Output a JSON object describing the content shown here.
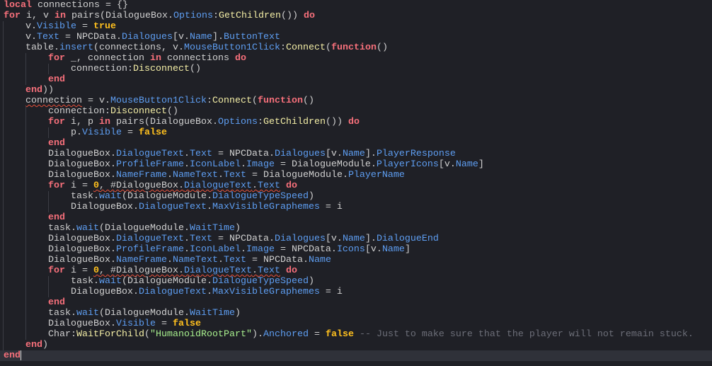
{
  "editor": {
    "current_line": 33,
    "lines": [
      {
        "indent": 0,
        "tokens": [
          [
            "k",
            "local"
          ],
          [
            "t",
            " connections = {}"
          ]
        ]
      },
      {
        "indent": 0,
        "tokens": [
          [
            "k",
            "for"
          ],
          [
            "t",
            " i, v "
          ],
          [
            "k",
            "in"
          ],
          [
            "t",
            " pairs(DialogueBox."
          ],
          [
            "p",
            "Options"
          ],
          [
            "t",
            ":"
          ],
          [
            "m",
            "GetChildren"
          ],
          [
            "t",
            "()) "
          ],
          [
            "k",
            "do"
          ]
        ]
      },
      {
        "indent": 1,
        "tokens": [
          [
            "t",
            "v."
          ],
          [
            "p",
            "Visible"
          ],
          [
            "t",
            " = "
          ],
          [
            "b",
            "true"
          ]
        ]
      },
      {
        "indent": 1,
        "tokens": [
          [
            "t",
            "v."
          ],
          [
            "p",
            "Text"
          ],
          [
            "t",
            " = NPCData."
          ],
          [
            "p",
            "Dialogues"
          ],
          [
            "t",
            "[v."
          ],
          [
            "p",
            "Name"
          ],
          [
            "t",
            "]."
          ],
          [
            "p",
            "ButtonText"
          ]
        ]
      },
      {
        "indent": 1,
        "tokens": [
          [
            "t",
            "table."
          ],
          [
            "p",
            "insert"
          ],
          [
            "t",
            "(connections, v."
          ],
          [
            "p",
            "MouseButton1Click"
          ],
          [
            "t",
            ":"
          ],
          [
            "m",
            "Connect"
          ],
          [
            "t",
            "("
          ],
          [
            "k",
            "function"
          ],
          [
            "t",
            "()"
          ]
        ]
      },
      {
        "indent": 2,
        "tokens": [
          [
            "k",
            "for"
          ],
          [
            "t",
            " _, connection "
          ],
          [
            "k",
            "in"
          ],
          [
            "t",
            " connections "
          ],
          [
            "k",
            "do"
          ]
        ]
      },
      {
        "indent": 3,
        "tokens": [
          [
            "t",
            "connection:"
          ],
          [
            "m",
            "Disconnect"
          ],
          [
            "t",
            "()"
          ]
        ]
      },
      {
        "indent": 2,
        "tokens": [
          [
            "k",
            "end"
          ]
        ]
      },
      {
        "indent": 1,
        "tokens": [
          [
            "k",
            "end"
          ],
          [
            "t",
            "))"
          ]
        ]
      },
      {
        "indent": 1,
        "tokens": [
          [
            "t u",
            "connection"
          ],
          [
            "t",
            " = v."
          ],
          [
            "p",
            "MouseButton1Click"
          ],
          [
            "t",
            ":"
          ],
          [
            "m",
            "Connect"
          ],
          [
            "t",
            "("
          ],
          [
            "k",
            "function"
          ],
          [
            "t",
            "()"
          ]
        ]
      },
      {
        "indent": 2,
        "tokens": [
          [
            "t",
            "connection:"
          ],
          [
            "m",
            "Disconnect"
          ],
          [
            "t",
            "()"
          ]
        ]
      },
      {
        "indent": 2,
        "tokens": [
          [
            "k",
            "for"
          ],
          [
            "t",
            " i, p "
          ],
          [
            "k",
            "in"
          ],
          [
            "t",
            " pairs(DialogueBox."
          ],
          [
            "p",
            "Options"
          ],
          [
            "t",
            ":"
          ],
          [
            "m",
            "GetChildren"
          ],
          [
            "t",
            "()) "
          ],
          [
            "k",
            "do"
          ]
        ]
      },
      {
        "indent": 3,
        "tokens": [
          [
            "t",
            "p."
          ],
          [
            "p",
            "Visible"
          ],
          [
            "t",
            " = "
          ],
          [
            "b",
            "false"
          ]
        ]
      },
      {
        "indent": 2,
        "tokens": [
          [
            "k",
            "end"
          ]
        ]
      },
      {
        "indent": 2,
        "tokens": [
          [
            "t",
            "DialogueBox."
          ],
          [
            "p",
            "DialogueText"
          ],
          [
            "t",
            "."
          ],
          [
            "p",
            "Text"
          ],
          [
            "t",
            " = NPCData."
          ],
          [
            "p",
            "Dialogues"
          ],
          [
            "t",
            "[v."
          ],
          [
            "p",
            "Name"
          ],
          [
            "t",
            "]."
          ],
          [
            "p",
            "PlayerResponse"
          ]
        ]
      },
      {
        "indent": 2,
        "tokens": [
          [
            "t",
            "DialogueBox."
          ],
          [
            "p",
            "ProfileFrame"
          ],
          [
            "t",
            "."
          ],
          [
            "p",
            "IconLabel"
          ],
          [
            "t",
            "."
          ],
          [
            "p",
            "Image"
          ],
          [
            "t",
            " = DialogueModule."
          ],
          [
            "p",
            "PlayerIcons"
          ],
          [
            "t",
            "[v."
          ],
          [
            "p",
            "Name"
          ],
          [
            "t",
            "]"
          ]
        ]
      },
      {
        "indent": 2,
        "tokens": [
          [
            "t",
            "DialogueBox."
          ],
          [
            "p",
            "NameFrame"
          ],
          [
            "t",
            "."
          ],
          [
            "p",
            "NameText"
          ],
          [
            "t",
            "."
          ],
          [
            "p",
            "Text"
          ],
          [
            "t",
            " = DialogueModule."
          ],
          [
            "p",
            "PlayerName"
          ]
        ]
      },
      {
        "indent": 2,
        "tokens": [
          [
            "k",
            "for"
          ],
          [
            "t",
            " i = "
          ],
          [
            "b u",
            "0"
          ],
          [
            "t u",
            ", #DialogueBox."
          ],
          [
            "p u",
            "DialogueText"
          ],
          [
            "t u",
            "."
          ],
          [
            "p u",
            "Text"
          ],
          [
            "t",
            " "
          ],
          [
            "k",
            "do"
          ]
        ]
      },
      {
        "indent": 3,
        "tokens": [
          [
            "t",
            "task."
          ],
          [
            "p",
            "wait"
          ],
          [
            "t",
            "(DialogueModule."
          ],
          [
            "p",
            "DialogueTypeSpeed"
          ],
          [
            "t",
            ")"
          ]
        ]
      },
      {
        "indent": 3,
        "tokens": [
          [
            "t",
            "DialogueBox."
          ],
          [
            "p",
            "DialogueText"
          ],
          [
            "t",
            "."
          ],
          [
            "p",
            "MaxVisibleGraphemes"
          ],
          [
            "t",
            " = i"
          ]
        ]
      },
      {
        "indent": 2,
        "tokens": [
          [
            "k",
            "end"
          ]
        ]
      },
      {
        "indent": 2,
        "tokens": [
          [
            "t",
            "task."
          ],
          [
            "p",
            "wait"
          ],
          [
            "t",
            "(DialogueModule."
          ],
          [
            "p",
            "WaitTime"
          ],
          [
            "t",
            ")"
          ]
        ]
      },
      {
        "indent": 2,
        "tokens": [
          [
            "t",
            "DialogueBox."
          ],
          [
            "p",
            "DialogueText"
          ],
          [
            "t",
            "."
          ],
          [
            "p",
            "Text"
          ],
          [
            "t",
            " = NPCData."
          ],
          [
            "p",
            "Dialogues"
          ],
          [
            "t",
            "[v."
          ],
          [
            "p",
            "Name"
          ],
          [
            "t",
            "]."
          ],
          [
            "p",
            "DialogueEnd"
          ]
        ]
      },
      {
        "indent": 2,
        "tokens": [
          [
            "t",
            "DialogueBox."
          ],
          [
            "p",
            "ProfileFrame"
          ],
          [
            "t",
            "."
          ],
          [
            "p",
            "IconLabel"
          ],
          [
            "t",
            "."
          ],
          [
            "p",
            "Image"
          ],
          [
            "t",
            " = NPCData."
          ],
          [
            "p",
            "Icons"
          ],
          [
            "t",
            "[v."
          ],
          [
            "p",
            "Name"
          ],
          [
            "t",
            "]"
          ]
        ]
      },
      {
        "indent": 2,
        "tokens": [
          [
            "t",
            "DialogueBox."
          ],
          [
            "p",
            "NameFrame"
          ],
          [
            "t",
            "."
          ],
          [
            "p",
            "NameText"
          ],
          [
            "t",
            "."
          ],
          [
            "p",
            "Text"
          ],
          [
            "t",
            " = NPCData."
          ],
          [
            "p",
            "Name"
          ]
        ]
      },
      {
        "indent": 2,
        "tokens": [
          [
            "k",
            "for"
          ],
          [
            "t",
            " i = "
          ],
          [
            "b u",
            "0"
          ],
          [
            "t u",
            ", #DialogueBox."
          ],
          [
            "p u",
            "DialogueText"
          ],
          [
            "t u",
            "."
          ],
          [
            "p u",
            "Text"
          ],
          [
            "t",
            " "
          ],
          [
            "k",
            "do"
          ]
        ]
      },
      {
        "indent": 3,
        "tokens": [
          [
            "t",
            "task."
          ],
          [
            "p",
            "wait"
          ],
          [
            "t",
            "(DialogueModule."
          ],
          [
            "p",
            "DialogueTypeSpeed"
          ],
          [
            "t",
            ")"
          ]
        ]
      },
      {
        "indent": 3,
        "tokens": [
          [
            "t",
            "DialogueBox."
          ],
          [
            "p",
            "DialogueText"
          ],
          [
            "t",
            "."
          ],
          [
            "p",
            "MaxVisibleGraphemes"
          ],
          [
            "t",
            " = i"
          ]
        ]
      },
      {
        "indent": 2,
        "tokens": [
          [
            "k",
            "end"
          ]
        ]
      },
      {
        "indent": 2,
        "tokens": [
          [
            "t",
            "task."
          ],
          [
            "p",
            "wait"
          ],
          [
            "t",
            "(DialogueModule."
          ],
          [
            "p",
            "WaitTime"
          ],
          [
            "t",
            ")"
          ]
        ]
      },
      {
        "indent": 2,
        "tokens": [
          [
            "t",
            "DialogueBox."
          ],
          [
            "p",
            "Visible"
          ],
          [
            "t",
            " = "
          ],
          [
            "b",
            "false"
          ]
        ]
      },
      {
        "indent": 2,
        "tokens": [
          [
            "t",
            "Char:"
          ],
          [
            "m",
            "WaitForChild"
          ],
          [
            "t",
            "("
          ],
          [
            "s",
            "\"HumanoidRootPart\""
          ],
          [
            "t",
            ")."
          ],
          [
            "p",
            "Anchored"
          ],
          [
            "t",
            " = "
          ],
          [
            "b",
            "false"
          ],
          [
            "c",
            " -- Just to make sure that the player will not remain stuck."
          ]
        ]
      },
      {
        "indent": 1,
        "tokens": [
          [
            "k",
            "end"
          ],
          [
            "t",
            ")"
          ]
        ]
      },
      {
        "indent": 0,
        "tokens": [
          [
            "k",
            "end"
          ]
        ]
      }
    ]
  }
}
